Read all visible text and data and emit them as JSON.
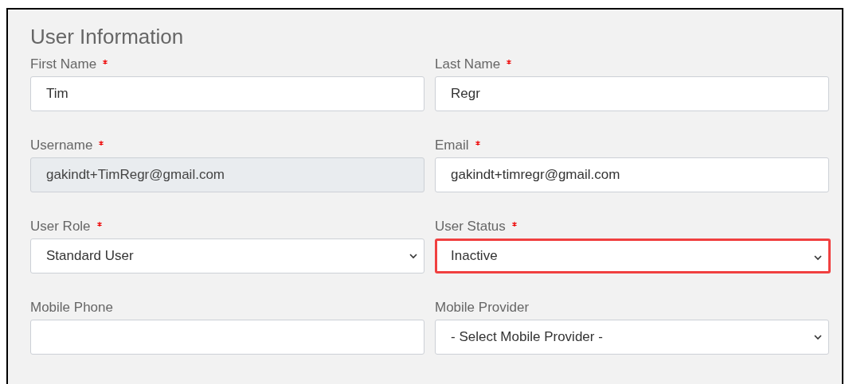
{
  "title": "User Information",
  "fields": [
    {
      "label": "First Name",
      "required": true,
      "kind": "text",
      "value": "Tim",
      "disabled": false,
      "highlighted": false
    },
    {
      "label": "Last Name",
      "required": true,
      "kind": "text",
      "value": "Regr",
      "disabled": false,
      "highlighted": false
    },
    {
      "label": "Username",
      "required": true,
      "kind": "text",
      "value": "gakindt+TimRegr@gmail.com",
      "disabled": true,
      "highlighted": false
    },
    {
      "label": "Email",
      "required": true,
      "kind": "text",
      "value": "gakindt+timregr@gmail.com",
      "disabled": false,
      "highlighted": false
    },
    {
      "label": "User Role",
      "required": true,
      "kind": "select",
      "value": "Standard User",
      "disabled": false,
      "highlighted": false
    },
    {
      "label": "User Status",
      "required": true,
      "kind": "select",
      "value": "Inactive",
      "disabled": false,
      "highlighted": true
    },
    {
      "label": "Mobile Phone",
      "required": false,
      "kind": "text",
      "disabled": false,
      "highlighted": false
    },
    {
      "label": "Mobile Provider",
      "required": false,
      "kind": "select",
      "value": "- Select Mobile Provider -",
      "disabled": false,
      "highlighted": false
    }
  ]
}
